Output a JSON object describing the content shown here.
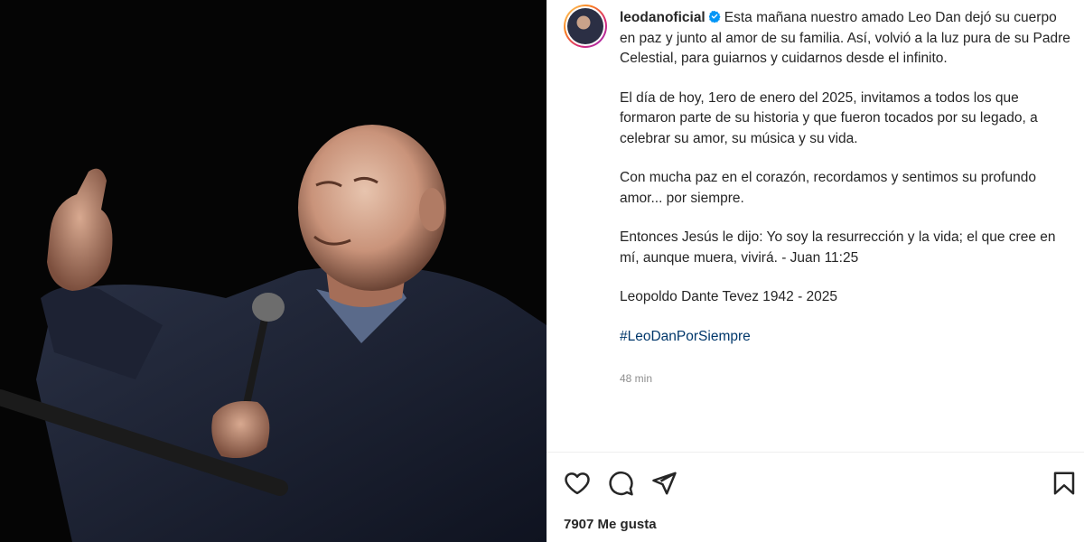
{
  "post": {
    "author": {
      "username": "leodanoficial",
      "verified": true
    },
    "caption": {
      "intro": "Esta mañana nuestro amado Leo Dan dejó su cuerpo en paz y junto al amor de su familia. Así, volvió a la luz pura de su Padre Celestial, para guiarnos y cuidarnos desde el infinito.",
      "paragraph_2": "El día de hoy, 1ero de enero del 2025, invitamos a todos los que formaron parte de su historia y que fueron tocados por su legado, a celebrar su amor, su música y su vida.",
      "paragraph_3": "Con mucha paz en el corazón, recordamos y sentimos su profundo amor... por siempre.",
      "paragraph_4": "Entonces Jesús le dijo: Yo soy la resurrección y la vida; el que cree en mí, aunque muera, vivirá. - Juan 11:25",
      "paragraph_5": "Leopoldo Dante Tevez 1942 - 2025",
      "hashtag": "#LeoDanPorSiempre"
    },
    "time_ago": "48 min",
    "likes_text": "7907 Me gusta",
    "icons": {
      "like": "heart-icon",
      "comment": "comment-icon",
      "share": "send-icon",
      "save": "bookmark-icon",
      "verified": "verified-badge-icon"
    },
    "colors": {
      "text": "#262626",
      "hashtag": "#00376b",
      "muted": "#8e8e8e",
      "verified": "#0095f6"
    }
  }
}
